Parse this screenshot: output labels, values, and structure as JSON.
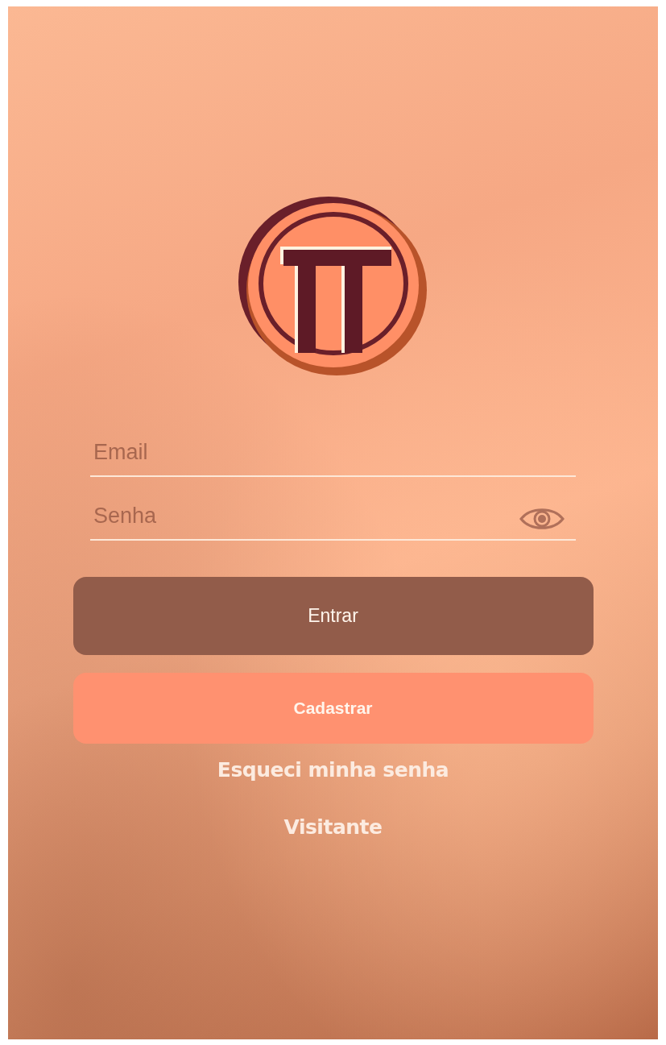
{
  "fields": [
    {
      "kind": "text",
      "placeholder": "Email"
    },
    {
      "kind": "password",
      "placeholder": "Senha"
    }
  ],
  "buttons": [
    {
      "kind": "primary",
      "label": "Entrar"
    },
    {
      "kind": "secondary",
      "label": "Cadastrar"
    }
  ],
  "links": [
    "Esqueci minha senha",
    "Visitante"
  ]
}
